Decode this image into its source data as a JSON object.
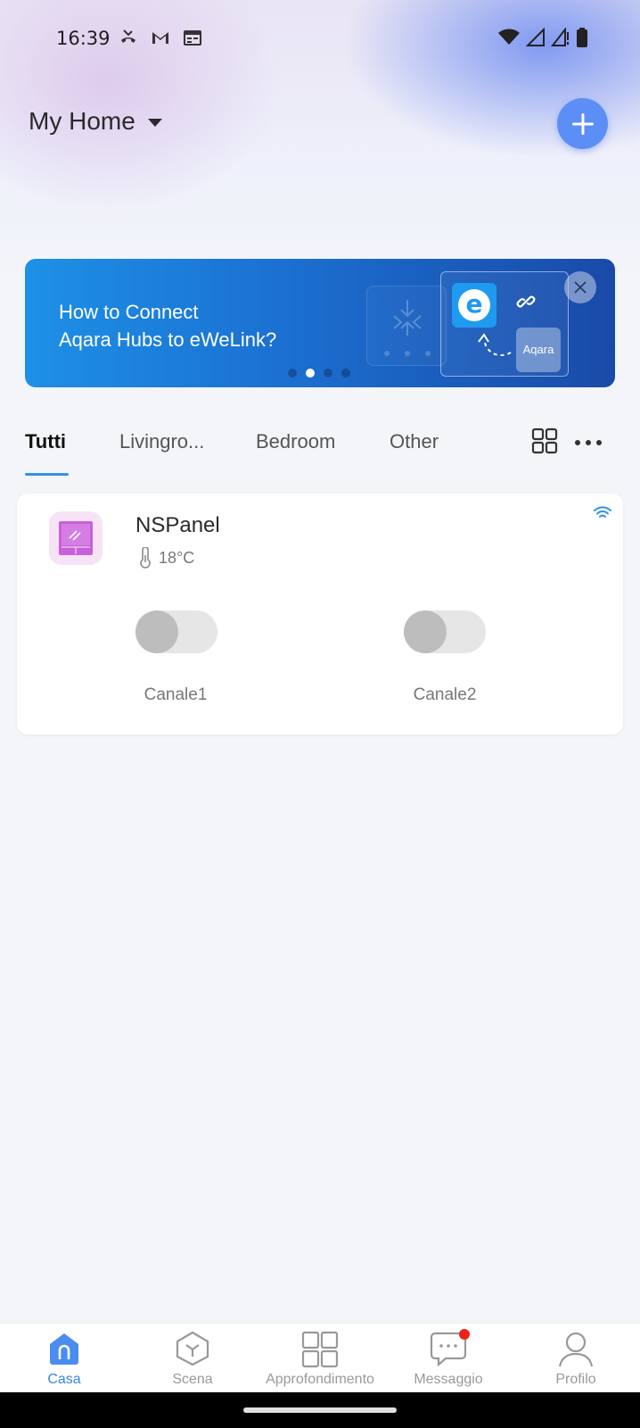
{
  "status_bar": {
    "time": "16:39",
    "left_icons": [
      "missed-call-icon",
      "gmail-icon",
      "calendar-icon"
    ],
    "right_icons": [
      "wifi-icon",
      "signal-icon",
      "signal-alert-icon",
      "battery-icon"
    ]
  },
  "header": {
    "home_name": "My Home",
    "add_icon": "plus-icon"
  },
  "banner": {
    "line1": "How to Connect",
    "line2": "Aqara Hubs to eWeLink?",
    "ewelink_letter": "e",
    "aqara_label": "Aqara",
    "page_count": 4,
    "active_page": 2
  },
  "tabs": {
    "items": [
      {
        "label": "Tutti",
        "active": true
      },
      {
        "label": "Livingro...",
        "active": false
      },
      {
        "label": "Bedroom",
        "active": false
      },
      {
        "label": "Other",
        "active": false
      }
    ]
  },
  "device": {
    "name": "NSPanel",
    "temperature": "18°C",
    "online": true,
    "channels": [
      {
        "label": "Canale1",
        "on": false
      },
      {
        "label": "Canale2",
        "on": false
      }
    ]
  },
  "bottom_nav": {
    "items": [
      {
        "label": "Casa",
        "icon": "home-icon",
        "active": true
      },
      {
        "label": "Scena",
        "icon": "scene-cube-icon",
        "active": false
      },
      {
        "label": "Approfondimento",
        "icon": "grid-icon",
        "active": false
      },
      {
        "label": "Messaggio",
        "icon": "message-icon",
        "active": false,
        "badge": true
      },
      {
        "label": "Profilo",
        "icon": "profile-icon",
        "active": false
      }
    ]
  },
  "colors": {
    "accent": "#5b8ff6",
    "tab_underline": "#2f93e6",
    "nav_active": "#3b82e6",
    "badge": "#f0211d",
    "banner_start": "#1e90e6",
    "banner_end": "#1a4aa8"
  }
}
